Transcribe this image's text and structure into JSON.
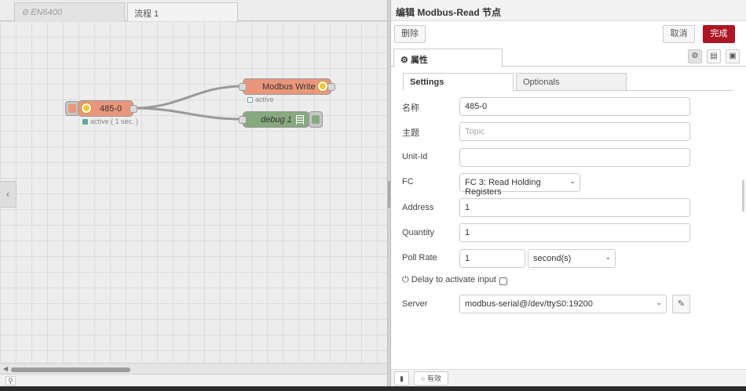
{
  "workspace": {
    "tabs": [
      {
        "label": "EN6400",
        "icon": "disabled-icon"
      },
      {
        "label": "流程 1"
      }
    ],
    "nodes": {
      "inject": {
        "label": "485-0",
        "status": "active ( 1 sec. )",
        "color": "#e9967a"
      },
      "write": {
        "label": "Modbus Write",
        "status": "active",
        "color": "#e9967a"
      },
      "debug": {
        "label": "debug 1",
        "color": "#87a980"
      }
    },
    "sidebar_toggle_icon": "chevron-left-icon",
    "zoom_icon": "search-icon"
  },
  "editor": {
    "title": "编辑 Modbus-Read 节点",
    "delete_label": "删除",
    "cancel_label": "取消",
    "done_label": "完成",
    "properties_tab": "属性",
    "subtabs": {
      "settings": "Settings",
      "optionals": "Optionals"
    },
    "fields": {
      "name": {
        "label": "名称",
        "value": "485-0"
      },
      "topic": {
        "label": "主题",
        "placeholder": "Topic"
      },
      "unit_id": {
        "label": "Unit-Id",
        "value": ""
      },
      "fc": {
        "label": "FC",
        "value": "FC 3: Read Holding Registers"
      },
      "address": {
        "label": "Address",
        "value": "1"
      },
      "quantity": {
        "label": "Quantity",
        "value": "1"
      },
      "poll_rate": {
        "label": "Poll Rate",
        "value": "1",
        "unit": "second(s)"
      },
      "delay": {
        "label": "Delay to activate input",
        "checked": false
      },
      "server": {
        "label": "Server",
        "value": "modbus-serial@/dev/ttyS0:19200"
      }
    },
    "footer": {
      "enabled_label": "有效"
    },
    "accent_color": "#ad1625"
  }
}
